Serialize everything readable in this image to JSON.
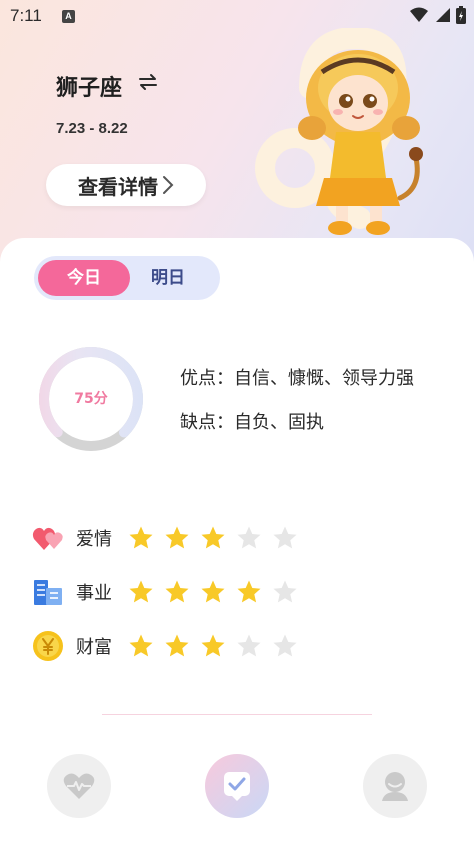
{
  "status_bar": {
    "time": "7:11",
    "a_badge": "A"
  },
  "header": {
    "sign_name": "狮子座",
    "dates": "7.23 - 8.22",
    "details_label": "查看详情",
    "swap_icon": "swap-arrows-icon",
    "illustration": "leo-girl-illustration"
  },
  "tabs": [
    {
      "label": "今日",
      "active": true
    },
    {
      "label": "明日",
      "active": false
    }
  ],
  "score": {
    "text": "75分",
    "value": 75
  },
  "traits": {
    "pros": "优点：自信、慷慨、领导力强",
    "cons": "缺点：自负、固执"
  },
  "ratings": [
    {
      "label": "爱情",
      "icon": "hearts-icon",
      "stars": 3,
      "max": 5
    },
    {
      "label": "事业",
      "icon": "buildings-icon",
      "stars": 4,
      "max": 5
    },
    {
      "label": "财富",
      "icon": "coin-icon",
      "stars": 3,
      "max": 5
    }
  ],
  "bottom_nav": [
    {
      "name": "health",
      "icon": "heartbeat-icon",
      "active": false
    },
    {
      "name": "horoscope",
      "icon": "check-chat-icon",
      "active": true
    },
    {
      "name": "profile",
      "icon": "person-icon",
      "active": false
    }
  ],
  "colors": {
    "accent_pink": "#f4689a",
    "tab_bg": "#e3e8fb",
    "star_filled": "#f8c928",
    "star_empty": "#e6e6e6"
  }
}
